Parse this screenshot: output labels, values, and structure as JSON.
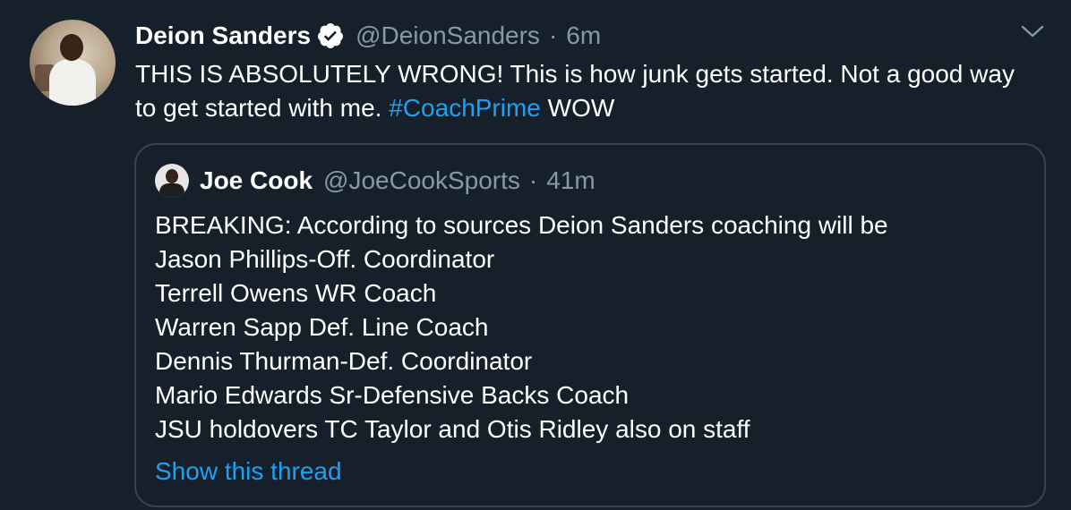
{
  "tweet": {
    "author_name": "Deion Sanders",
    "author_handle": "@DeionSanders",
    "separator": "·",
    "time": "6m",
    "text_main": "THIS IS ABSOLUTELY WRONG! This is how junk gets started. Not a good way to get started with me. ",
    "hashtag": "#CoachPrime",
    "text_after": " WOW"
  },
  "quoted": {
    "author_name": "Joe Cook",
    "author_handle": "@JoeCookSports",
    "separator": "·",
    "time": "41m",
    "lines": [
      "BREAKING: According to sources Deion Sanders coaching will be",
      "Jason Phillips-Off. Coordinator",
      "Terrell Owens WR Coach",
      "Warren Sapp Def. Line Coach",
      "Dennis Thurman-Def. Coordinator",
      "Mario Edwards Sr-Defensive Backs Coach",
      "JSU holdovers TC Taylor and Otis Ridley also on staff"
    ],
    "show_thread_label": "Show this thread"
  },
  "icons": {
    "verified": "verified-badge-icon",
    "more": "chevron-down-icon"
  },
  "colors": {
    "background": "#15202b",
    "link": "#1da1f2",
    "secondary_text": "#8899a6",
    "border": "#38444d"
  }
}
